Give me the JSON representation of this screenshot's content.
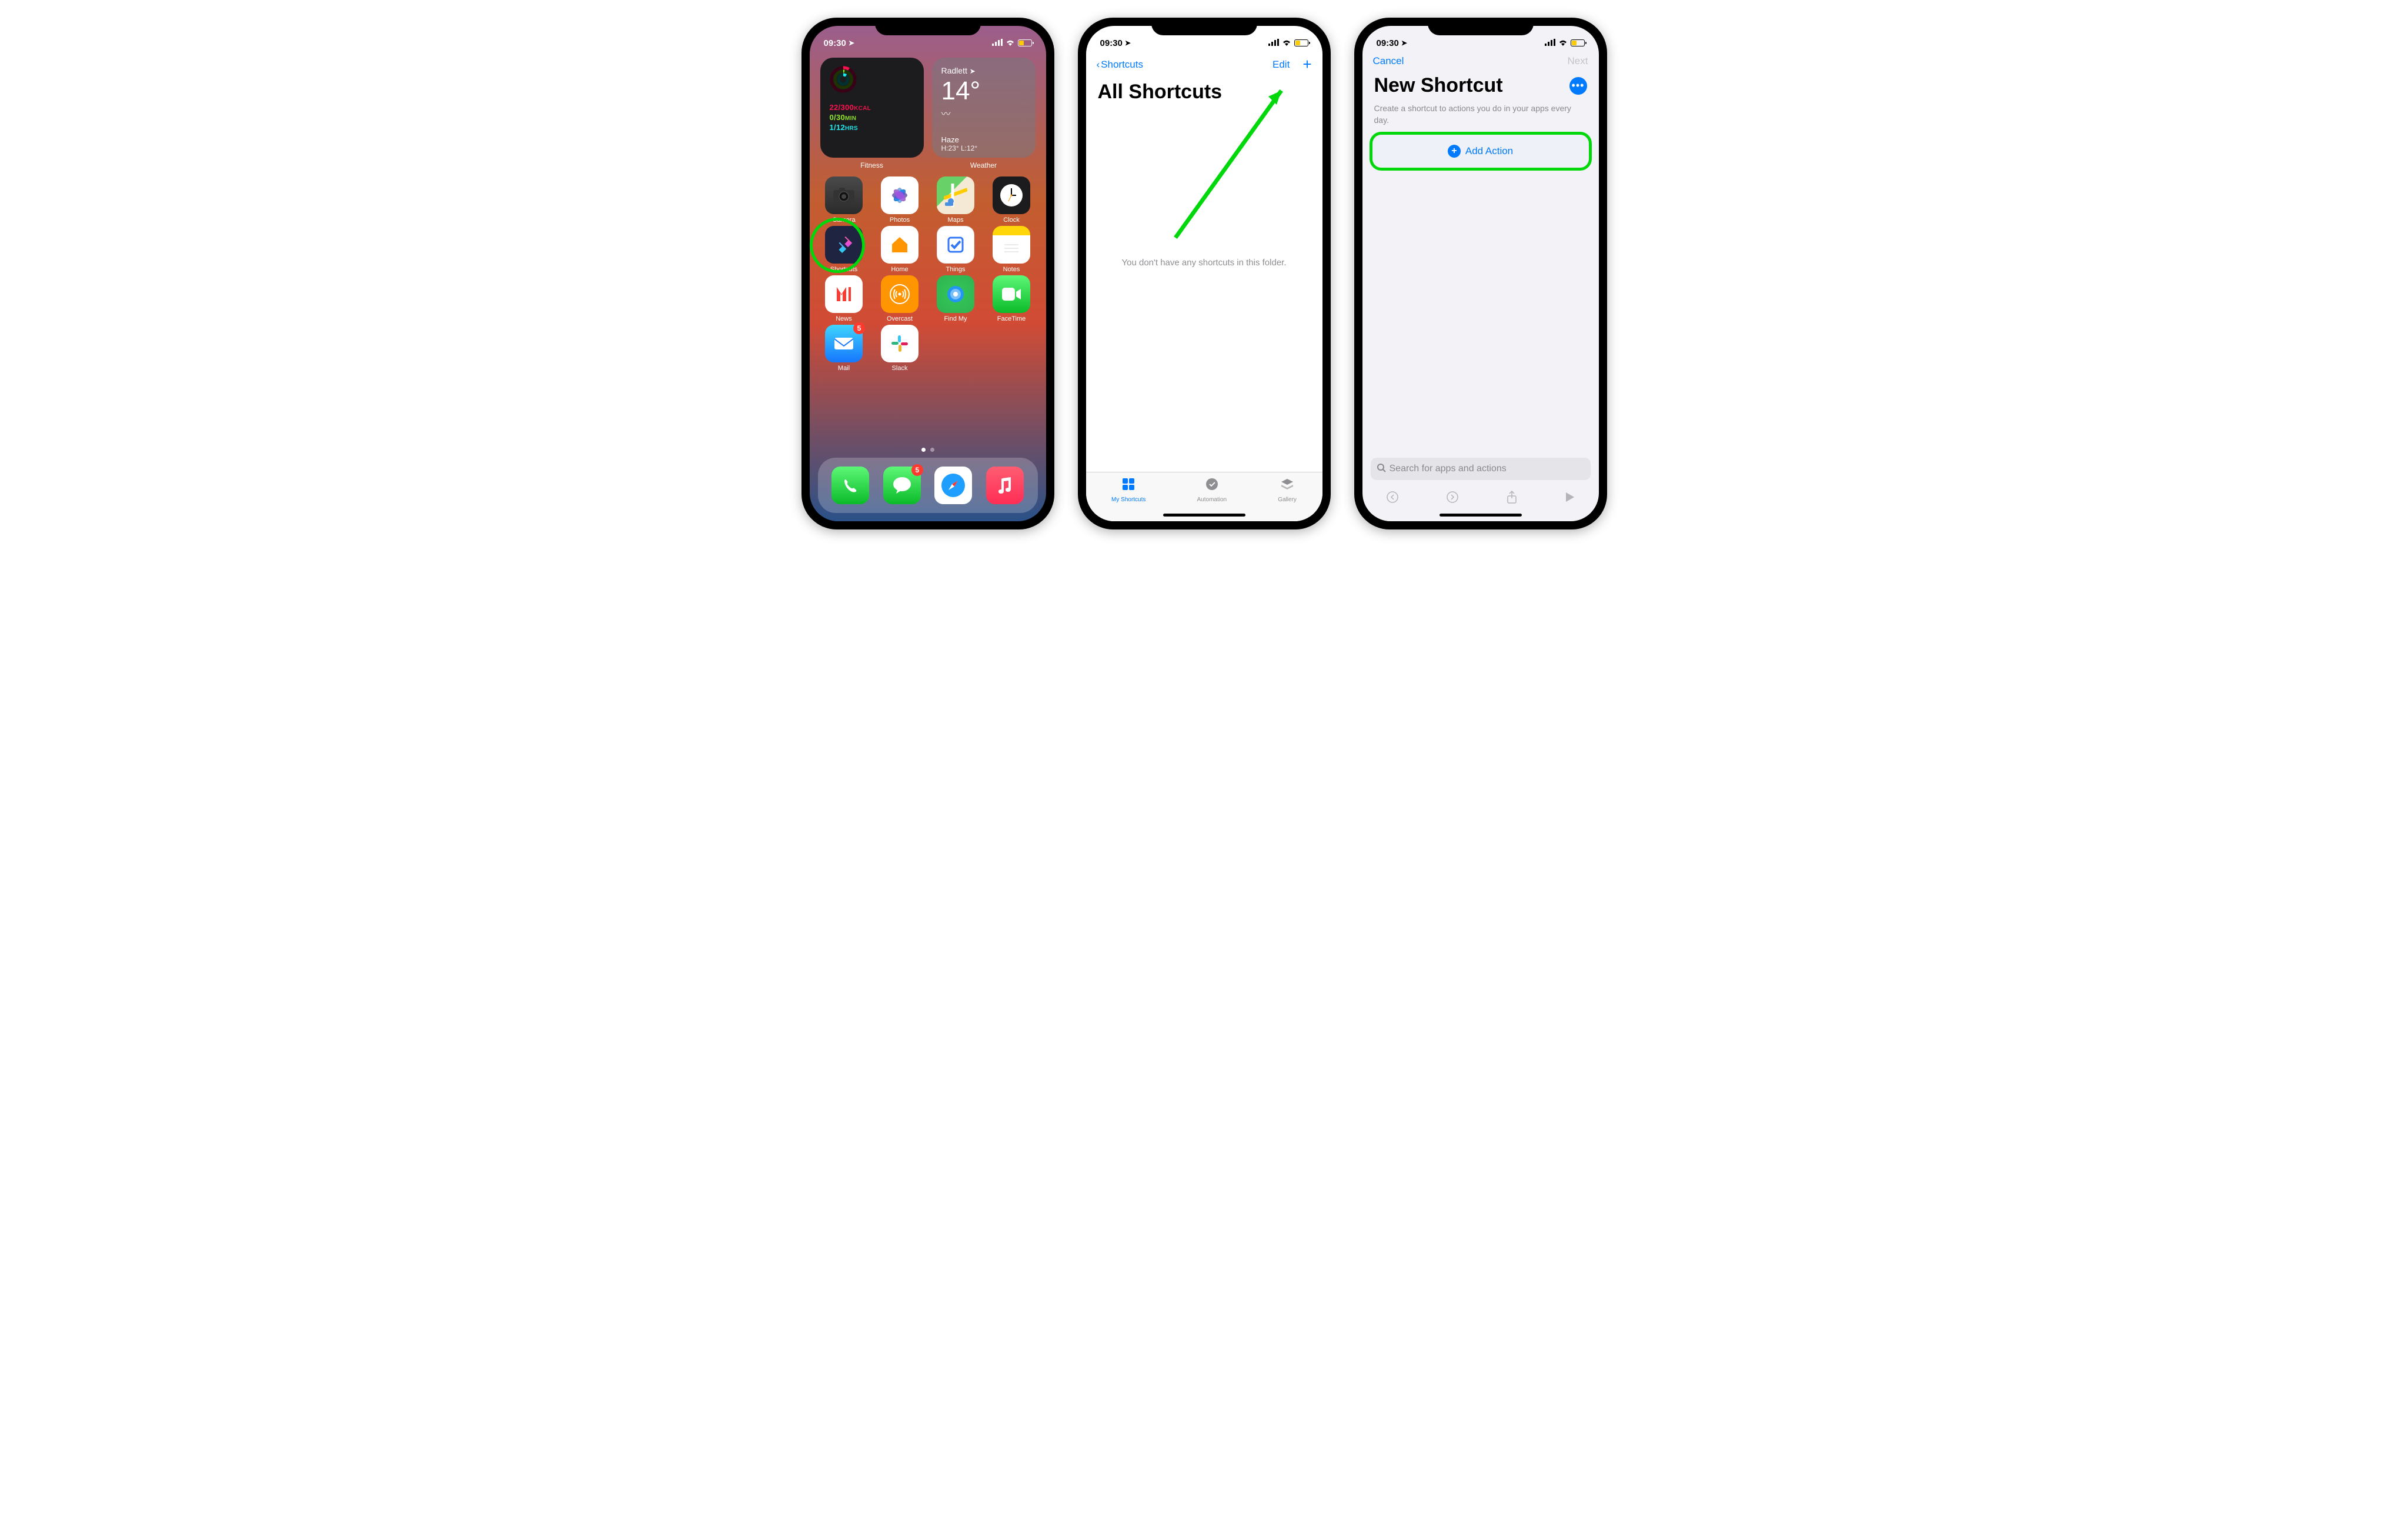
{
  "status": {
    "time": "09:30"
  },
  "home": {
    "widgets": {
      "fitness": {
        "label": "Fitness",
        "move": "22/300",
        "move_unit": "KCAL",
        "exercise": "0/30",
        "exercise_unit": "MIN",
        "stand": "1/12",
        "stand_unit": "HRS"
      },
      "weather": {
        "label": "Weather",
        "location": "Radlett",
        "temp": "14°",
        "condition": "Haze",
        "hilo": "H:23° L:12°"
      }
    },
    "apps": {
      "camera": "Camera",
      "photos": "Photos",
      "maps": "Maps",
      "clock": "Clock",
      "shortcuts": "Shortcuts",
      "home_app": "Home",
      "things": "Things",
      "notes": "Notes",
      "news": "News",
      "overcast": "Overcast",
      "findmy": "Find My",
      "facetime": "FaceTime",
      "mail": "Mail",
      "slack": "Slack"
    },
    "badges": {
      "mail": "5",
      "messages": "5"
    }
  },
  "shortcuts": {
    "back": "Shortcuts",
    "edit": "Edit",
    "title": "All Shortcuts",
    "empty": "You don't have any shortcuts in this folder.",
    "tabs": {
      "my": "My Shortcuts",
      "automation": "Automation",
      "gallery": "Gallery"
    }
  },
  "newshortcut": {
    "cancel": "Cancel",
    "next": "Next",
    "title": "New Shortcut",
    "desc": "Create a shortcut to actions you do in your apps every day.",
    "add_action": "Add Action",
    "search_placeholder": "Search for apps and actions"
  }
}
